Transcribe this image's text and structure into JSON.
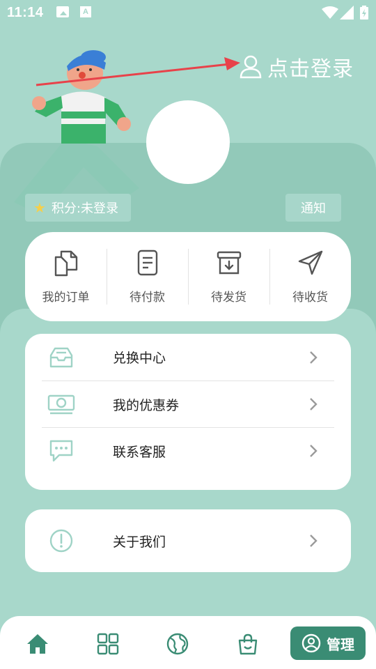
{
  "status_bar": {
    "time": "11:14",
    "icons": [
      "photo-icon",
      "a-notification-icon",
      "wifi-icon",
      "signal-icon",
      "battery-charging-icon"
    ]
  },
  "header": {
    "login_text": "点击登录",
    "login_icon": "user-outline-icon",
    "points_label": "积分:未登录",
    "notify_label": "通知"
  },
  "orders": [
    {
      "label": "我的订单",
      "icon": "documents-icon"
    },
    {
      "label": "待付款",
      "icon": "receipt-icon"
    },
    {
      "label": "待发货",
      "icon": "archive-box-icon"
    },
    {
      "label": "待收货",
      "icon": "paper-plane-icon"
    }
  ],
  "menu": [
    {
      "label": "兑换中心",
      "icon": "inbox-tray-icon"
    },
    {
      "label": "我的优惠券",
      "icon": "banknote-icon"
    },
    {
      "label": "联系客服",
      "icon": "chat-bubble-icon"
    }
  ],
  "about": {
    "label": "关于我们",
    "icon": "exclamation-circle-icon"
  },
  "bottom_nav": {
    "items": [
      "home-icon",
      "grid-icon",
      "globe-icon",
      "shopping-bag-icon"
    ],
    "manage_label": "管理"
  },
  "colors": {
    "background": "#a8d8cb",
    "header_card": "#92c9b9",
    "accent": "#3a8c74",
    "icon_tint": "#9fd3c6",
    "star": "#f5cf4a"
  }
}
